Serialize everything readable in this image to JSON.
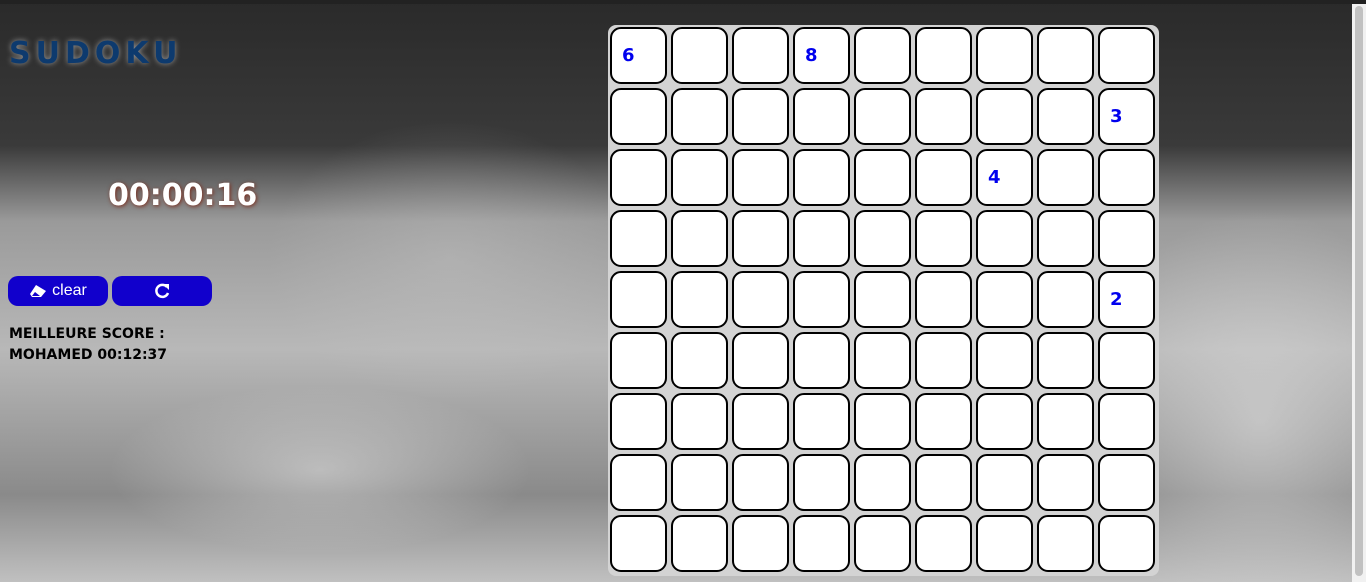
{
  "title": "SUDOKU",
  "timer": "00:00:16",
  "buttons": {
    "clear_label": "clear",
    "clear_icon": "eraser-icon",
    "reset_icon": "redo-icon"
  },
  "best_score": {
    "label": "MEILLEURE SCORE :",
    "value": "MOHAMED 00:12:37"
  },
  "colors": {
    "button": "#1100cc",
    "given": "#0000ee",
    "title": "#0d3a6e"
  },
  "grid": [
    [
      "6",
      "",
      "",
      "8",
      "",
      "",
      "",
      "",
      ""
    ],
    [
      "",
      "",
      "",
      "",
      "",
      "",
      "",
      "",
      "3"
    ],
    [
      "",
      "",
      "",
      "",
      "",
      "",
      "4",
      "",
      ""
    ],
    [
      "",
      "",
      "",
      "",
      "",
      "",
      "",
      "",
      ""
    ],
    [
      "",
      "",
      "",
      "",
      "",
      "",
      "",
      "",
      "2"
    ],
    [
      "",
      "",
      "",
      "",
      "",
      "",
      "",
      "",
      ""
    ],
    [
      "",
      "",
      "",
      "",
      "",
      "",
      "",
      "",
      ""
    ],
    [
      "",
      "",
      "",
      "",
      "",
      "",
      "",
      "",
      ""
    ],
    [
      "",
      "",
      "",
      "",
      "",
      "",
      "",
      "",
      ""
    ]
  ]
}
